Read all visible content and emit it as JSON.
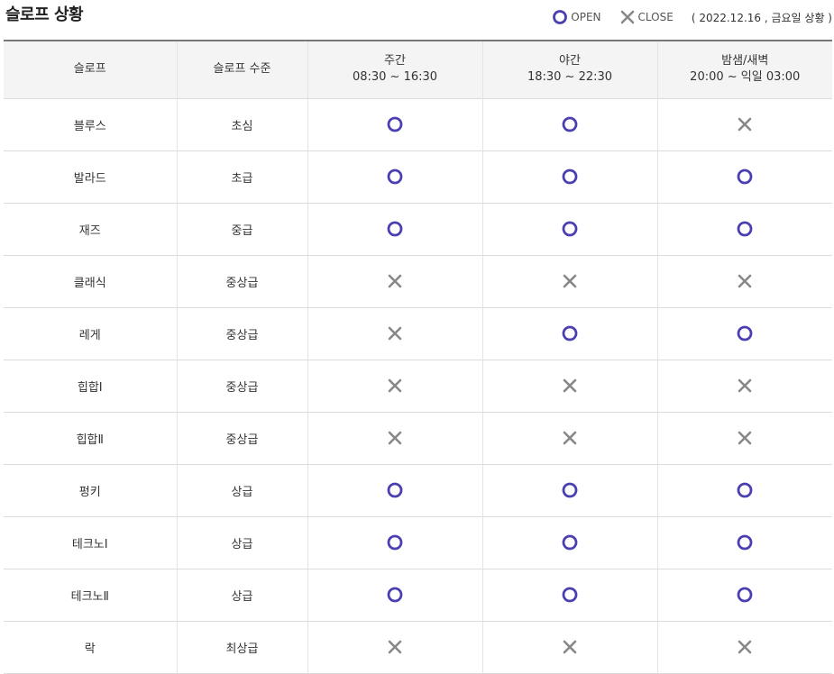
{
  "title": "슬로프 상황",
  "legend": {
    "open_label": "OPEN",
    "close_label": "CLOSE",
    "date": "( 2022.12.16 , 금요일 상황 )"
  },
  "colors": {
    "open": "#4a3fb0",
    "close": "#888888"
  },
  "columns": [
    {
      "name": "슬로프",
      "time": ""
    },
    {
      "name": "슬로프 수준",
      "time": ""
    },
    {
      "name": "주간",
      "time": "08:30 ~ 16:30"
    },
    {
      "name": "야간",
      "time": "18:30 ~ 22:30"
    },
    {
      "name": "밤샘/새벽",
      "time": "20:00 ~ 익일 03:00"
    }
  ],
  "rows": [
    {
      "slope": "블루스",
      "level": "초심",
      "status": [
        "open",
        "open",
        "close"
      ]
    },
    {
      "slope": "발라드",
      "level": "초급",
      "status": [
        "open",
        "open",
        "open"
      ]
    },
    {
      "slope": "재즈",
      "level": "중급",
      "status": [
        "open",
        "open",
        "open"
      ]
    },
    {
      "slope": "클래식",
      "level": "중상급",
      "status": [
        "close",
        "close",
        "close"
      ]
    },
    {
      "slope": "레게",
      "level": "중상급",
      "status": [
        "close",
        "open",
        "open"
      ]
    },
    {
      "slope": "힙합Ⅰ",
      "level": "중상급",
      "status": [
        "close",
        "close",
        "close"
      ]
    },
    {
      "slope": "힙합Ⅱ",
      "level": "중상급",
      "status": [
        "close",
        "close",
        "close"
      ]
    },
    {
      "slope": "펑키",
      "level": "상급",
      "status": [
        "open",
        "open",
        "open"
      ]
    },
    {
      "slope": "테크노Ⅰ",
      "level": "상급",
      "status": [
        "open",
        "open",
        "open"
      ]
    },
    {
      "slope": "테크노Ⅱ",
      "level": "상급",
      "status": [
        "open",
        "open",
        "open"
      ]
    },
    {
      "slope": "락",
      "level": "최상급",
      "status": [
        "close",
        "close",
        "close"
      ]
    }
  ]
}
